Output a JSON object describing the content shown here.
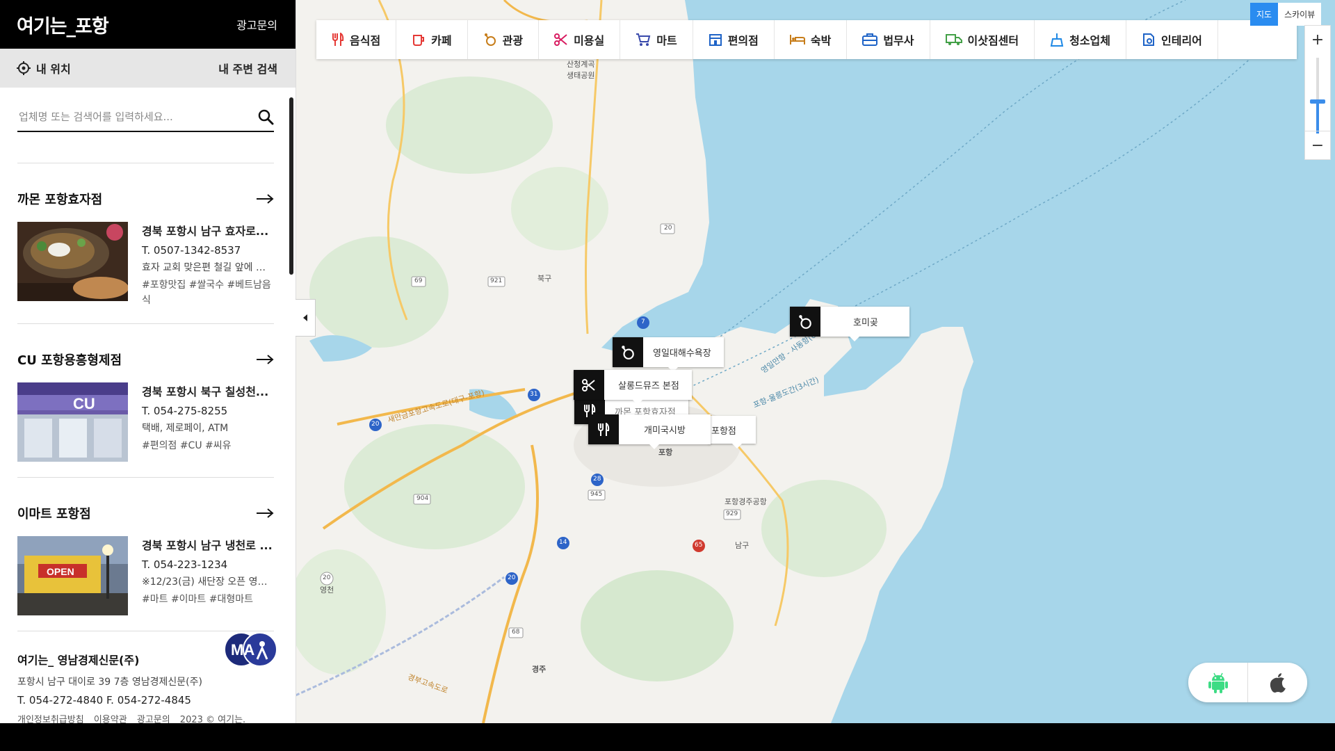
{
  "brand": "여기는_포항",
  "header_ad": "광고문의",
  "location_bar": {
    "my_location": "내 위치",
    "nearby_search": "내 주변 검색"
  },
  "search": {
    "placeholder": "업체명 또는 검색어를 입력하세요..."
  },
  "listings": [
    {
      "name": "까몬 포항효자점",
      "address": "경북 포항시 남구 효자로...",
      "phone": "T. 0507-1342-8537",
      "desc": "효자 교회 맞은편 철길 앞에 위...",
      "tags": "#포항맛집 #쌀국수 #베트남음식"
    },
    {
      "name": "CU 포항용흥형제점",
      "address": "경북 포항시 북구 칠성천...",
      "phone": "T. 054-275-8255",
      "desc": "택배, 제로페이, ATM",
      "tags": "#편의점 #CU #씨유"
    },
    {
      "name": "이마트 포항점",
      "address": "경북 포항시 남구 냉천로 ...",
      "phone": "T. 054-223-1234",
      "desc": "※12/23(금) 새단장 오픈 영업...",
      "tags": "#마트 #이마트 #대형마트"
    }
  ],
  "footer": {
    "company": "여기는_ 영남경제신문(주)",
    "address": "포항시 남구 대이로 39 7층 영남경제신문(주)",
    "tel": "T. 054-272-4840 F. 054-272-4845",
    "links": [
      "개인정보취급방침",
      "이용약관",
      "광고문의",
      "2023 © 여기는."
    ],
    "logo_text": "MA"
  },
  "categories": [
    {
      "label": "음식점",
      "icon": "fork-knife-icon",
      "color": "#e53935"
    },
    {
      "label": "카페",
      "icon": "cup-icon",
      "color": "#e53935"
    },
    {
      "label": "관광",
      "icon": "tour-icon",
      "color": "#c77d1a"
    },
    {
      "label": "미용실",
      "icon": "scissors-icon",
      "color": "#d81b60"
    },
    {
      "label": "마트",
      "icon": "cart-icon",
      "color": "#3949ab"
    },
    {
      "label": "편의점",
      "icon": "store-icon",
      "color": "#1e63c7"
    },
    {
      "label": "숙박",
      "icon": "bed-icon",
      "color": "#c77d1a"
    },
    {
      "label": "법무사",
      "icon": "briefcase-icon",
      "color": "#1e63c7"
    },
    {
      "label": "이삿짐센터",
      "icon": "truck-icon",
      "color": "#43a047"
    },
    {
      "label": "청소업체",
      "icon": "broom-icon",
      "color": "#1e88e5"
    },
    {
      "label": "인테리어",
      "icon": "interior-icon",
      "color": "#1e63c7"
    }
  ],
  "map_type": {
    "map": "지도",
    "skyview": "스카이뷰"
  },
  "zoom": {
    "in": "+",
    "out": "−"
  },
  "markers": [
    {
      "label": "호미곶",
      "icon": "tour-icon"
    },
    {
      "label": "영일대해수욕장",
      "icon": "tour-icon"
    },
    {
      "label": "살롱드뮤즈 본점",
      "icon": "scissors-icon"
    },
    {
      "label": "까몬 포항효자점",
      "icon": "fork-knife-icon"
    },
    {
      "label": "개미국시방",
      "icon": "fork-knife-icon"
    },
    {
      "label": "포항점",
      "icon": "cart-icon"
    }
  ],
  "map_labels": [
    "북구",
    "남구",
    "포항",
    "경주",
    "영천",
    "포항경주공항",
    "산청계곡 생태공원",
    "새만금포항고속도로(대구-포항)",
    "경부고속도로",
    "포항-울릉도간(3시간)",
    "영일만항 - 사동항(6시간)"
  ],
  "road_numbers": [
    "20",
    "69",
    "921",
    "7",
    "31",
    "20",
    "28",
    "945",
    "904",
    "14",
    "20",
    "68",
    "929",
    "65",
    "20"
  ],
  "colors": {
    "accent": "#2a8cf0",
    "sea": "#a7d6ea",
    "land": "#f3f2ee"
  }
}
